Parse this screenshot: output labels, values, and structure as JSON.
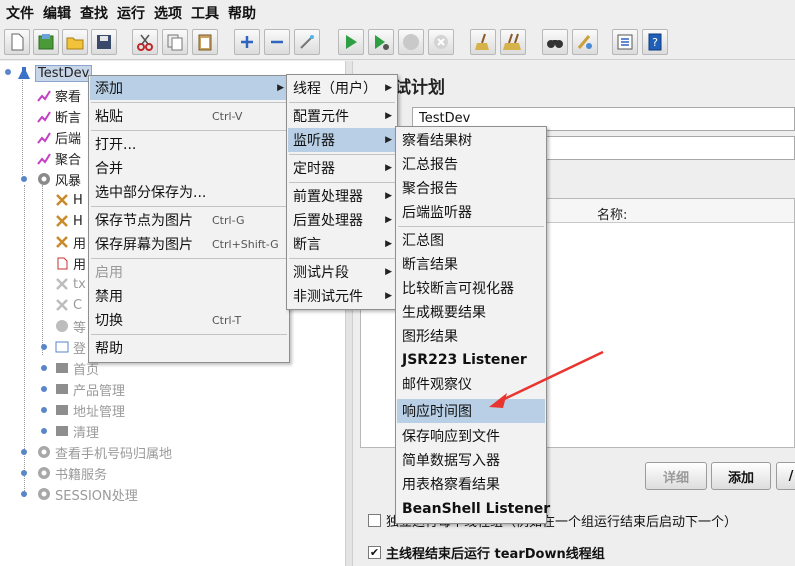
{
  "menubar": [
    "文件",
    "编辑",
    "查找",
    "运行",
    "选项",
    "工具",
    "帮助"
  ],
  "tree": {
    "root": "TestDev",
    "items": [
      {
        "label": "察看"
      },
      {
        "label": "断言"
      },
      {
        "label": "后端"
      },
      {
        "label": "聚合"
      },
      {
        "label": "风暴"
      },
      {
        "label": "H"
      },
      {
        "label": "H"
      },
      {
        "label": "用"
      },
      {
        "label": "用"
      },
      {
        "label": "tx"
      },
      {
        "label": "C"
      },
      {
        "label": "等"
      },
      {
        "label": "登"
      },
      {
        "label": "首页"
      },
      {
        "label": "产品管理"
      },
      {
        "label": "地址管理"
      },
      {
        "label": "清理"
      },
      {
        "label": "查看手机号码归属地"
      },
      {
        "label": "书籍服务"
      },
      {
        "label": "SESSION处理"
      }
    ]
  },
  "right": {
    "title": "试计划",
    "name_value": "TestDev",
    "col_name": "名称:",
    "btn_detail": "详细",
    "btn_add": "添加",
    "btn_more": "/",
    "cb1": "独立运行每个线程组（例如在一个组运行结束后启动下一个）",
    "cb1_visible": "□",
    "cb1_text": "独",
    "cb1_text_tail": "例如在一个组运行结束后启动下一个）",
    "cb2": "主线程结束后运行 tearDown线程组"
  },
  "menu1": {
    "items": [
      {
        "label": "添加",
        "submenu": true
      },
      {
        "label": "粘贴",
        "shortcut": "Ctrl-V"
      },
      {
        "label": "打开..."
      },
      {
        "label": "合并"
      },
      {
        "label": "选中部分保存为..."
      },
      {
        "label": "保存节点为图片",
        "shortcut": "Ctrl-G"
      },
      {
        "label": "保存屏幕为图片",
        "shortcut": "Ctrl+Shift-G"
      },
      {
        "label": "启用",
        "disabled": true
      },
      {
        "label": "禁用"
      },
      {
        "label": "切换",
        "shortcut": "Ctrl-T"
      },
      {
        "label": "帮助"
      }
    ]
  },
  "menu2": {
    "items": [
      {
        "label": "线程（用户）"
      },
      {
        "label": "配置元件"
      },
      {
        "label": "监听器"
      },
      {
        "label": "定时器"
      },
      {
        "label": "前置处理器"
      },
      {
        "label": "后置处理器"
      },
      {
        "label": "断言"
      },
      {
        "label": "测试片段"
      },
      {
        "label": "非测试元件"
      }
    ]
  },
  "menu3": {
    "items": [
      {
        "label": "察看结果树"
      },
      {
        "label": "汇总报告"
      },
      {
        "label": "聚合报告"
      },
      {
        "label": "后端监听器"
      },
      {
        "label": "汇总图"
      },
      {
        "label": "断言结果"
      },
      {
        "label": "比较断言可视化器"
      },
      {
        "label": "生成概要结果"
      },
      {
        "label": "图形结果"
      },
      {
        "label": "JSR223 Listener"
      },
      {
        "label": "邮件观察仪"
      },
      {
        "label": "响应时间图"
      },
      {
        "label": "保存响应到文件"
      },
      {
        "label": "简单数据写入器"
      },
      {
        "label": "用表格察看结果"
      },
      {
        "label": "BeanShell Listener"
      }
    ]
  },
  "colors": {
    "highlight": "#b8cfe5",
    "annotation_arrow": "#e8352f"
  }
}
